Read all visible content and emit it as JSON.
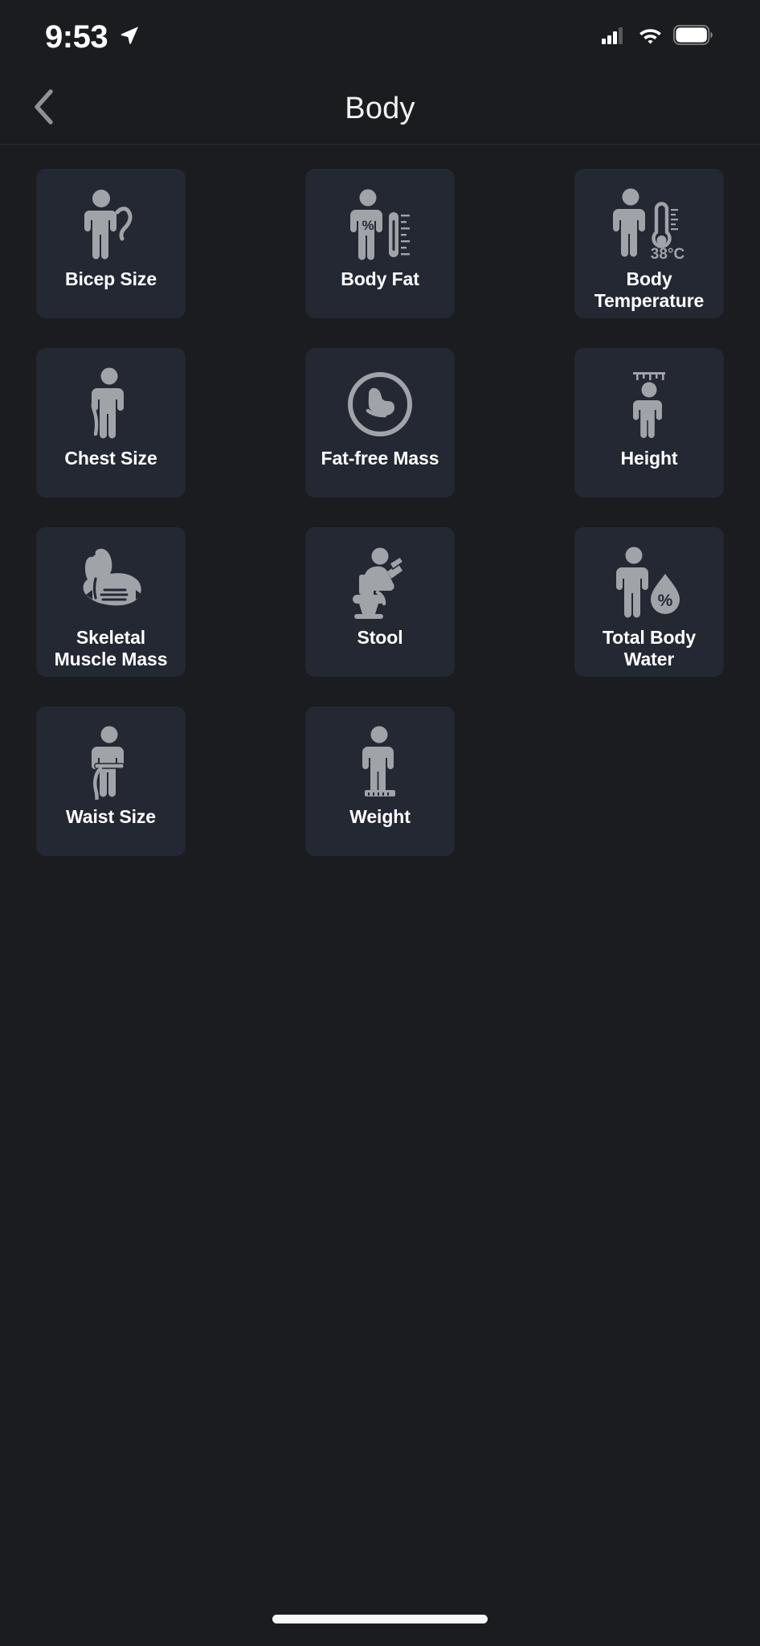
{
  "status_bar": {
    "time": "9:53",
    "location_icon": "location-arrow-icon",
    "cellular_icon": "cellular-signal-icon",
    "wifi_icon": "wifi-icon",
    "battery_icon": "battery-full-icon"
  },
  "header": {
    "back_icon": "chevron-left-icon",
    "title": "Body"
  },
  "colors": {
    "background": "#1a1c1f",
    "card": "#242833",
    "icon": "#a0a3a8",
    "label": "#ffffff",
    "divider": "#2b2e33"
  },
  "grid": {
    "items": [
      {
        "label": "Bicep Size",
        "icon": "person-flexing-bicep-icon"
      },
      {
        "label": "Body Fat",
        "icon": "person-percent-caliper-icon"
      },
      {
        "label": "Body\nTemperature",
        "icon": "person-thermometer-icon",
        "badge": "38°C"
      },
      {
        "label": "Chest Size",
        "icon": "person-chest-tape-icon"
      },
      {
        "label": "Fat-free Mass",
        "icon": "bicep-in-circle-icon"
      },
      {
        "label": "Height",
        "icon": "person-height-ruler-icon"
      },
      {
        "label": "Skeletal\nMuscle Mass",
        "icon": "flexed-arm-muscle-icon"
      },
      {
        "label": "Stool",
        "icon": "person-on-toilet-icon"
      },
      {
        "label": "Total Body\nWater",
        "icon": "person-water-drop-percent-icon"
      },
      {
        "label": "Waist Size",
        "icon": "person-waist-tape-icon"
      },
      {
        "label": "Weight",
        "icon": "person-on-scale-icon"
      }
    ]
  },
  "home_indicator": {
    "name": "home-indicator"
  }
}
